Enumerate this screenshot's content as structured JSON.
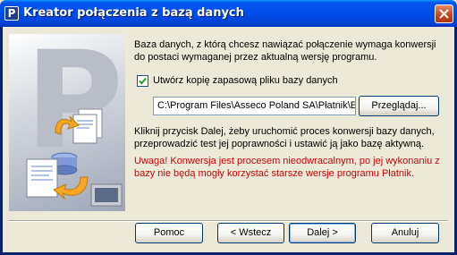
{
  "window": {
    "title": "Kreator połączenia z bazą danych",
    "icon": "platnik-app-icon",
    "close_icon": "close-icon"
  },
  "content": {
    "intro": "Baza danych, z którą chcesz nawiązać połączenie wymaga konwersji do postaci wymaganej przez aktualną wersję programu.",
    "backup_checkbox_label": "Utwórz kopię zapasową pliku bazy danych",
    "backup_checked": true,
    "backup_path": "C:\\Program Files\\Asseco Poland SA\\Płatnik\\E",
    "browse_label": "Przeglądaj...",
    "info": "Kliknij przycisk Dalej, żeby uruchomić proces konwersji bazy danych, przeprowadzić test jej poprawności i ustawić ją jako bazę aktywną.",
    "warning": "Uwaga! Konwersja jest procesem nieodwracalnym, po jej wykonaniu z bazy nie będą mogły korzystać starsze wersje programu Płatnik.",
    "warning_color": "#d40000"
  },
  "buttons": {
    "help": "Pomoc",
    "back": "< Wstecz",
    "next": "Dalej >",
    "cancel": "Anuluj"
  },
  "side_image": {
    "letter": "P"
  },
  "colors": {
    "title_bar": "#0053ee",
    "dialog_bg": "#ece9d8"
  }
}
